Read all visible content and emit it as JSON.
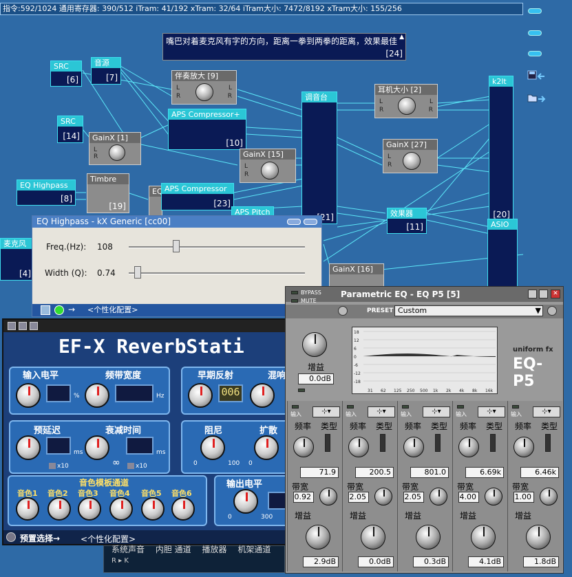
{
  "status": "指令:592/1024 通用寄存器: 390/512 iTram: 41/192 xTram: 32/64 iTram大小: 7472/8192 xTram大小: 155/256",
  "note": {
    "text": "嘴巴对着麦克风有字的方向，距离一拳到两拳的距离，效果最佳",
    "num": "[24]"
  },
  "nodes": {
    "src1": {
      "title": "SRC",
      "num": "[6]"
    },
    "yinyuan": {
      "title": "音源",
      "num": "[7]"
    },
    "banzou": {
      "title": "伴奏放大 [9]",
      "num": ""
    },
    "tiaoyintai": {
      "title": "调音台",
      "num": "[21]"
    },
    "erji": {
      "title": "耳机大小 [2]",
      "num": ""
    },
    "k2lt": {
      "title": "k2lt",
      "num": "[20]"
    },
    "apsplus": {
      "title": "APS Compressor+",
      "num": "[10]"
    },
    "src2": {
      "title": "SRC",
      "num": "[14]"
    },
    "gainx1": {
      "title": "GainX [1]",
      "num": ""
    },
    "gainx15": {
      "title": "GainX [15]",
      "num": ""
    },
    "gainx27": {
      "title": "GainX [27]",
      "num": ""
    },
    "eqhp": {
      "title": "EQ Highpass",
      "num": "[8]"
    },
    "timbre": {
      "title": "Timbre",
      "num": "[19]"
    },
    "eqsm": {
      "title": "EQ",
      "num": ""
    },
    "aps": {
      "title": "APS Compressor",
      "num": "[23]"
    },
    "apspitch": {
      "title": "APS Pitch",
      "num": ""
    },
    "xiaoguo": {
      "title": "效果器",
      "num": "[11]"
    },
    "asio": {
      "title": "ASIO",
      "num": ""
    },
    "mic": {
      "title": "麦克风",
      "num": "[4]"
    },
    "gainx16": {
      "title": "GainX [16]",
      "num": ""
    }
  },
  "lr": {
    "l": "L",
    "r": "R"
  },
  "eqgen": {
    "title": "EQ Highpass - kX Generic [cc00]",
    "freq_label": "Freq.(Hz):",
    "freq_value": "108",
    "freq_frac": 0.27,
    "width_label": "Width (Q):",
    "width_value": "0.74",
    "width_frac": 0.05,
    "footer": "<个性化配置>"
  },
  "reverb": {
    "logo": "EF-X ReverbStati",
    "input_level": "输入电平",
    "bandwidth": "频带宽度",
    "early": "早期反射",
    "mix": "混响",
    "predelay": "预延迟",
    "decay": "衰减时间",
    "damping": "阻尼",
    "diffuse": "扩散",
    "timbre_title": "音色模板通道",
    "output": "输出电平",
    "timbres": [
      "音色1",
      "音色2",
      "音色3",
      "音色4",
      "音色5",
      "音色6"
    ],
    "lcd_early": "006",
    "u_pct": "%",
    "u_hz": "Hz",
    "u_ms": "ms",
    "u_ms2": "ms",
    "x10": "x10",
    "x10b": "x10",
    "inf": "∞",
    "zero": "0",
    "hundred": "100",
    "zero2": "0",
    "hundred2": "100",
    "zero3": "0",
    "three": "300",
    "preset_label": "预置选择→",
    "preset_value": "<个性化配置>",
    "tabs": [
      "系统声音",
      "内胆 通道",
      "播放器",
      "机架通道"
    ]
  },
  "peq": {
    "bypass": "BYPASS",
    "mute": "MUTE",
    "title": "Parametric EQ - EQ P5 [5]",
    "preset_label": "PRESET",
    "preset_value": "Custom",
    "gain_label": "增益",
    "master_gain": "0.0dB",
    "brand": "uniform fx",
    "model": "EQ-P5",
    "graph_y": [
      "18",
      "12",
      "6",
      "0",
      "-6",
      "-12",
      "-18"
    ],
    "graph_x": [
      "31",
      "62",
      "125",
      "250",
      "500",
      "1k",
      "2k",
      "4k",
      "8k",
      "16k"
    ],
    "input_label": "输入",
    "freq_label": "频率",
    "type_label": "类型",
    "bw_label": "带宽",
    "gain2_label": "增益",
    "bands": [
      {
        "freq": "71.9",
        "bw": "0.92",
        "gain": "2.9dB"
      },
      {
        "freq": "200.5",
        "bw": "2.05",
        "gain": "0.0dB"
      },
      {
        "freq": "801.0",
        "bw": "2.05",
        "gain": "0.3dB"
      },
      {
        "freq": "6.69k",
        "bw": "4.00",
        "gain": "4.1dB"
      },
      {
        "freq": "6.46k",
        "bw": "1.00",
        "gain": "1.8dB"
      }
    ]
  }
}
